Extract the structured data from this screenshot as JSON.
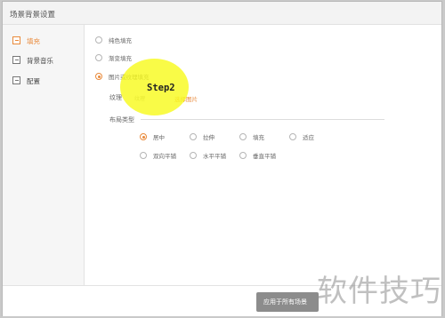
{
  "dialog": {
    "title": "场景背景设置"
  },
  "sidebar": {
    "items": [
      {
        "label": "填充",
        "icon": "fill-icon",
        "active": true
      },
      {
        "label": "背景音乐",
        "icon": "music-icon",
        "active": false
      },
      {
        "label": "配置",
        "icon": "config-icon",
        "active": false
      }
    ]
  },
  "fill": {
    "options": [
      {
        "label": "纯色填充",
        "selected": false
      },
      {
        "label": "渐变填充",
        "selected": false
      },
      {
        "label": "图片或纹理填充",
        "selected": true
      }
    ],
    "texture": {
      "label": "纹理",
      "value": "纹理",
      "link": "选择图片"
    },
    "layout": {
      "label": "布局类型",
      "options": [
        {
          "label": "居中",
          "selected": true
        },
        {
          "label": "拉伸",
          "selected": false
        },
        {
          "label": "填充",
          "selected": false
        },
        {
          "label": "适应",
          "selected": false
        },
        {
          "label": "双向平铺",
          "selected": false
        },
        {
          "label": "水平平铺",
          "selected": false
        },
        {
          "label": "垂直平铺",
          "selected": false
        }
      ]
    }
  },
  "overlay": {
    "step": "Step2"
  },
  "footer": {
    "apply_label": "应用于所有场景"
  },
  "watermark": "软件技巧",
  "colors": {
    "accent": "#e98a3b",
    "highlight": "#f8fa1e"
  }
}
